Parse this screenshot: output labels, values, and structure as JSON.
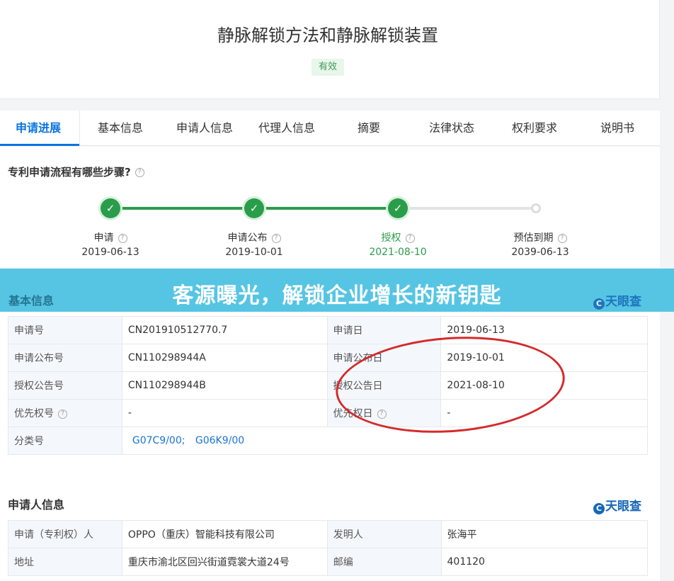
{
  "header": {
    "title": "静脉解锁方法和静脉解锁装置",
    "status": "有效"
  },
  "tabs": [
    {
      "label": "申请进展"
    },
    {
      "label": "基本信息"
    },
    {
      "label": "申请人信息"
    },
    {
      "label": "代理人信息"
    },
    {
      "label": "摘要"
    },
    {
      "label": "法律状态"
    },
    {
      "label": "权利要求"
    },
    {
      "label": "说明书"
    }
  ],
  "progress": {
    "question": "专利申请流程有哪些步骤?",
    "help_icon": "?",
    "steps": [
      {
        "label": "申请",
        "date": "2019-06-13",
        "state": "done"
      },
      {
        "label": "申请公布",
        "date": "2019-10-01",
        "state": "done"
      },
      {
        "label": "授权",
        "date": "2021-08-10",
        "state": "current"
      },
      {
        "label": "预估到期",
        "date": "2039-06-13",
        "state": "pending"
      }
    ],
    "check_glyph": "✓"
  },
  "banner": {
    "text": "客源曝光，解锁企业增长的新钥匙",
    "covered_heading": "基本信息",
    "brand": "天眼查",
    "brand_logo": "C"
  },
  "basic_info": {
    "rows": [
      {
        "k1": "申请号",
        "v1": "CN201910512770.7",
        "k2": "申请日",
        "v2": "2019-06-13"
      },
      {
        "k1": "申请公布号",
        "v1": "CN110298944A",
        "k2": "申请公布日",
        "v2": "2019-10-01"
      },
      {
        "k1": "授权公告号",
        "v1": "CN110298944B",
        "k2": "授权公告日",
        "v2": "2021-08-10"
      },
      {
        "k1": "优先权号",
        "v1": "-",
        "k2": "优先权日",
        "v2": "-"
      }
    ],
    "class_label": "分类号",
    "class_links": [
      "G07C9/00;",
      "G06K9/00"
    ]
  },
  "applicant_info": {
    "title": "申请人信息",
    "brand": "天眼查",
    "brand_logo": "C",
    "rows": [
      {
        "k1": "申请（专利权）人",
        "v1": "OPPO（重庆）智能科技有限公司",
        "k2": "发明人",
        "v2": "张海平"
      },
      {
        "k1": "地址",
        "v1": "重庆市渝北区回兴街道霓裳大道24号",
        "k2": "邮编",
        "v2": "401120"
      }
    ]
  },
  "colors": {
    "accent": "#0b74de",
    "green": "#2a9d4b",
    "banner": "#56c5e4",
    "annotation": "#d42a2a"
  }
}
